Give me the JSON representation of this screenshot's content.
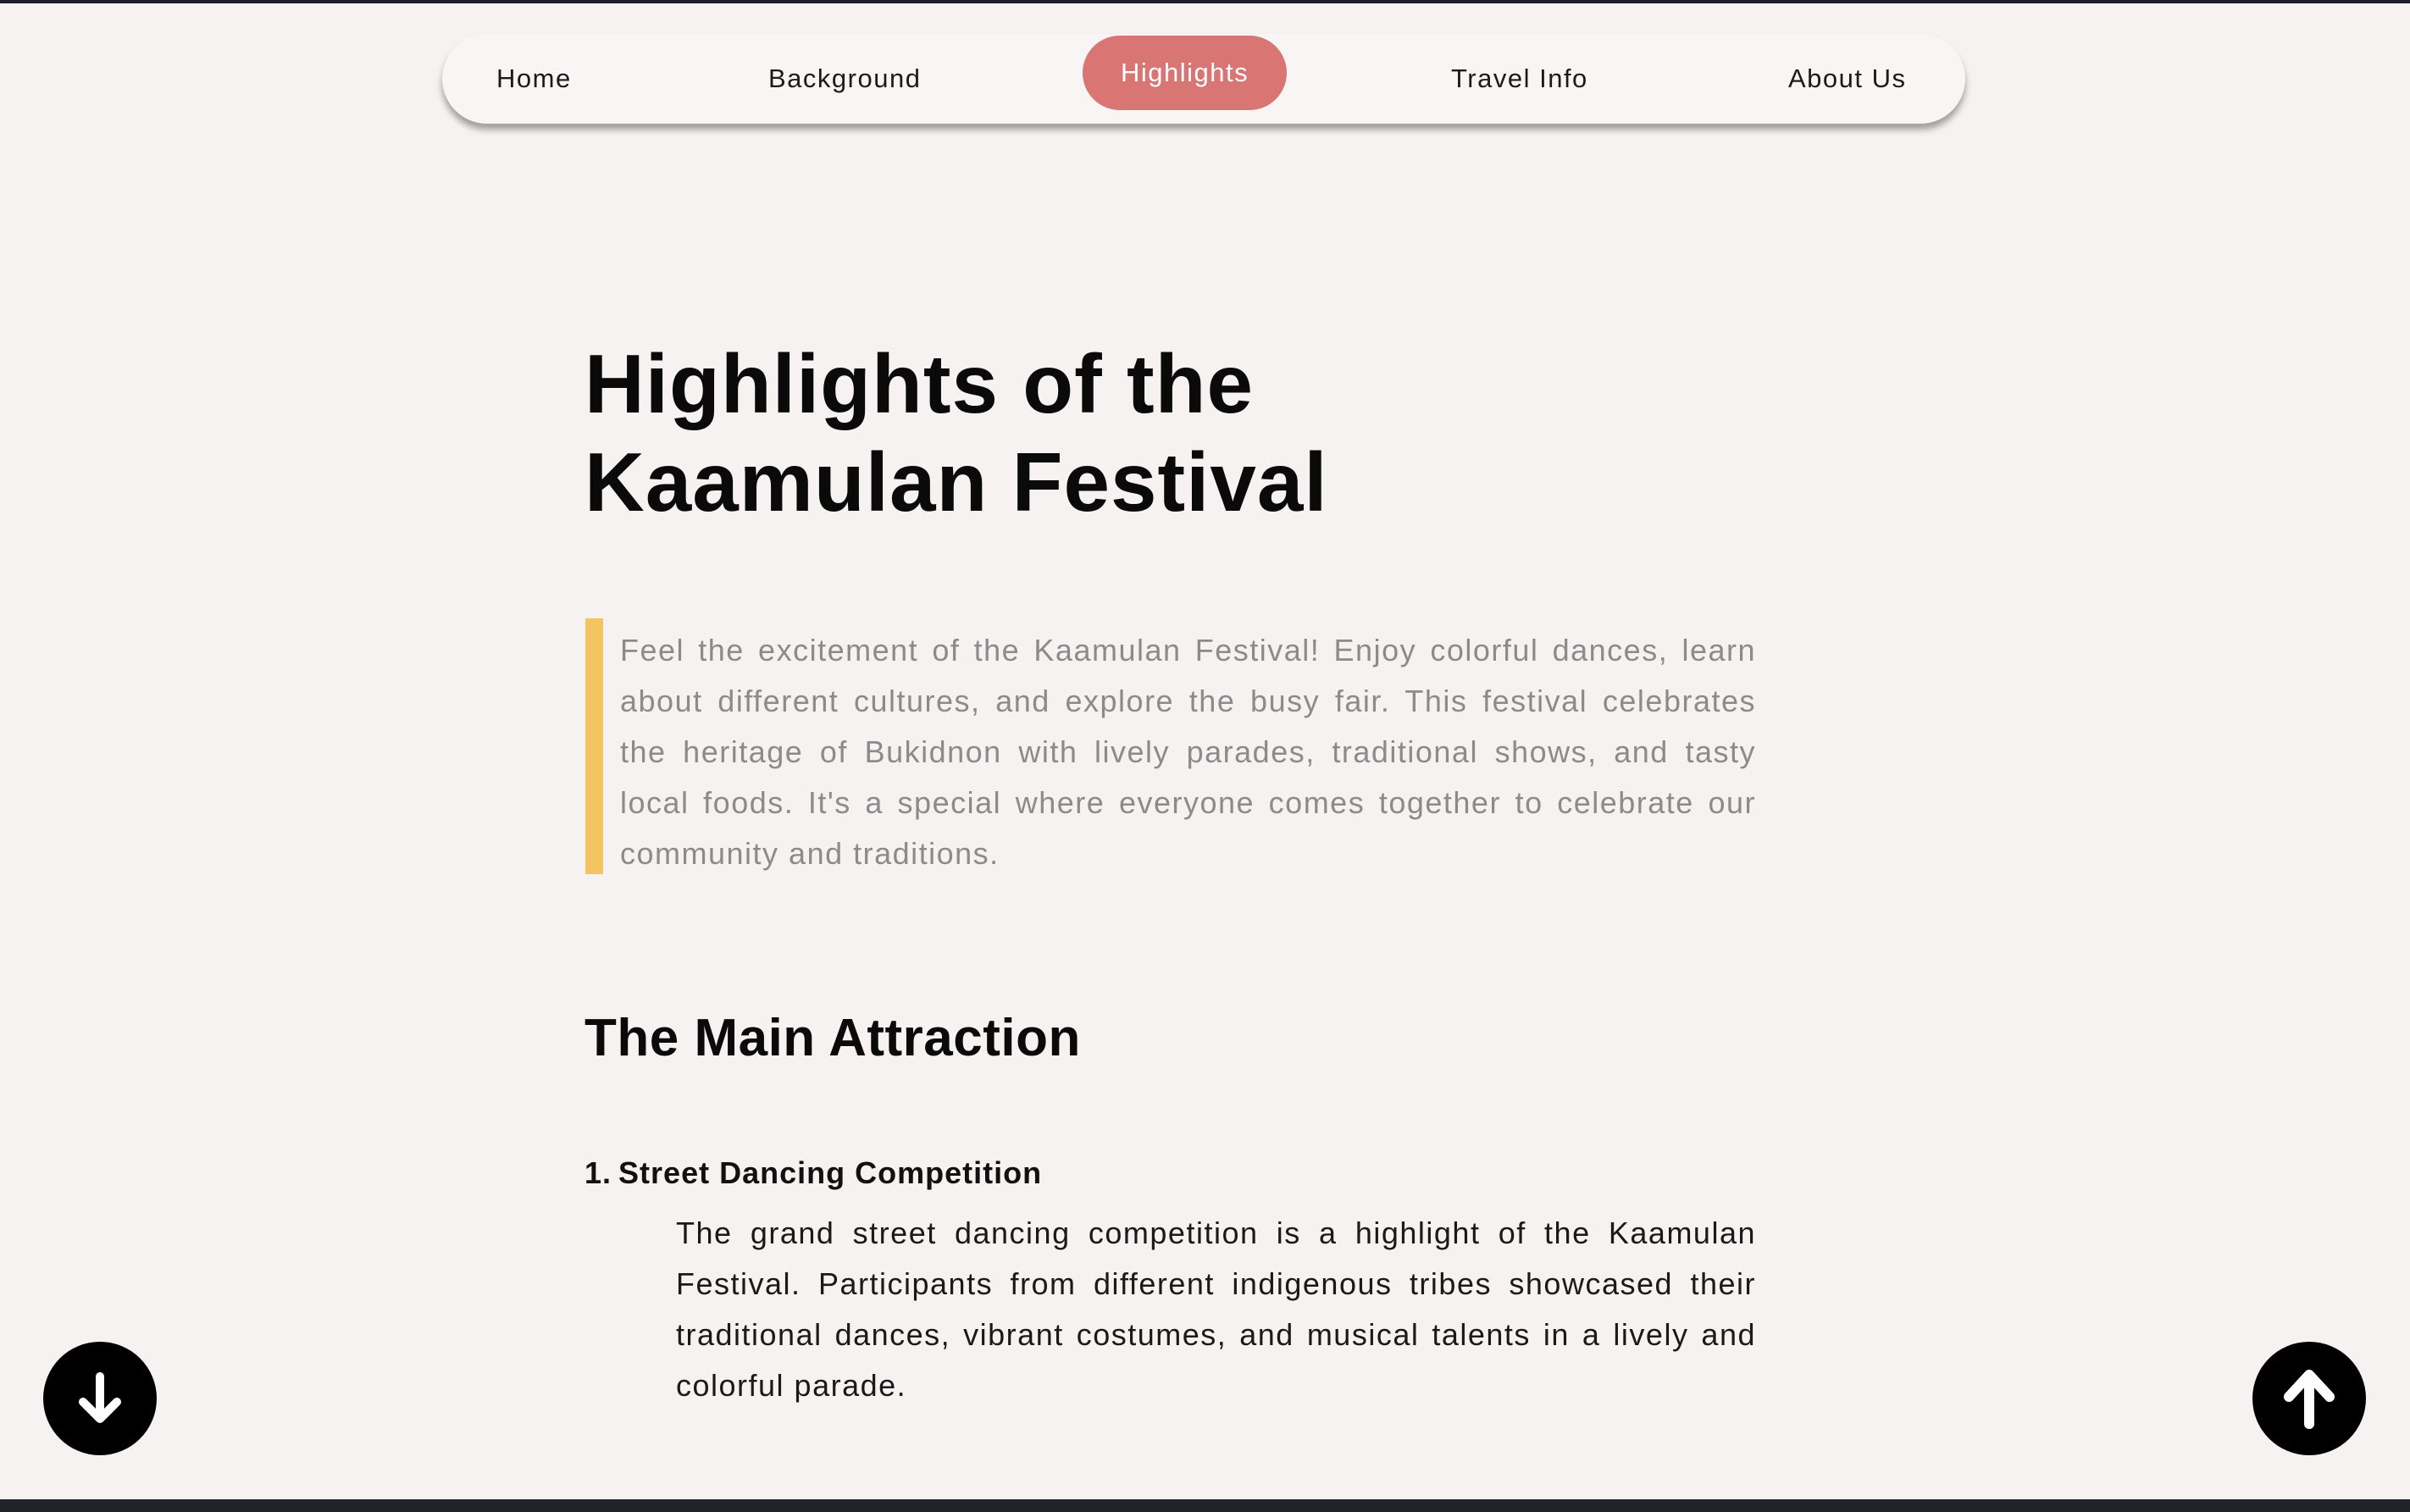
{
  "nav": {
    "items": [
      {
        "label": "Home",
        "active": false
      },
      {
        "label": "Background",
        "active": false
      },
      {
        "label": "Highlights",
        "active": true
      },
      {
        "label": "Travel Info",
        "active": false
      },
      {
        "label": "About Us",
        "active": false
      }
    ]
  },
  "page": {
    "title_line1": "Highlights of the",
    "title_line2": "Kaamulan Festival",
    "intro": "Feel the excitement of the Kaamulan Festival! Enjoy colorful dances, learn about different cultures, and explore the busy fair. This festival celebrates the heritage of Bukidnon with lively parades, traditional shows, and tasty local foods. It's a special where everyone comes together to celebrate our community and traditions."
  },
  "main_attraction": {
    "heading": "The Main Attraction",
    "items": [
      {
        "number": "1.",
        "title": "Street Dancing Competition",
        "description": "The grand street dancing competition is a highlight of the Kaamulan Festival. Participants from different indigenous tribes showcased their traditional dances, vibrant costumes, and musical talents in a lively and colorful parade."
      }
    ]
  },
  "controls": {
    "scroll_down_icon": "arrow-down-icon",
    "scroll_up_icon": "arrow-up-icon"
  },
  "colors": {
    "background": "#f6f2f1",
    "nav_active": "#d97572",
    "quote_accent": "#f3c560",
    "quote_text": "#8b8b8b",
    "fab": "#000000"
  }
}
